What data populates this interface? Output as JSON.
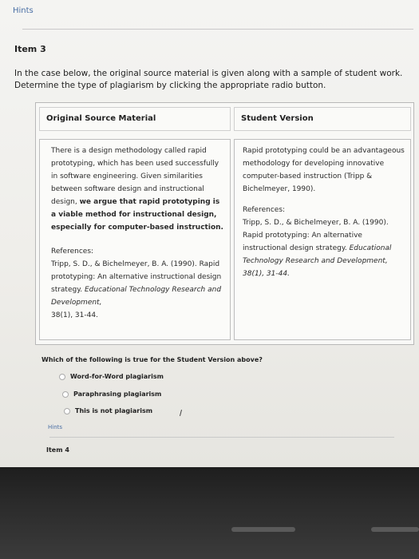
{
  "header": {
    "hints_label": "Hints"
  },
  "item": {
    "title": "Item 3"
  },
  "instructions": "In the case below, the original source material is given along with a sample of student work. Determine the type of plagiarism by clicking the appropriate radio button.",
  "table": {
    "left_header": "Original Source Material",
    "right_header": "Student Version",
    "original": {
      "p1": "There is a design methodology called rapid prototyping, which has been used successfully in software engineering. Given similarities between software design and instructional design, ",
      "p1_bold": "we argue that rapid prototyping is a viable method for instructional design, especially for computer-based instruction.",
      "ref_label": "References:",
      "ref_text": "Tripp, S. D., & Bichelmeyer, B. A. (1990). Rapid prototyping: An alternative instructional design strategy. ",
      "ref_italic": "Educational Technology Research and Development,",
      "ref_end": "38(1), 31-44."
    },
    "student": {
      "p1": "Rapid prototyping could be an advantageous methodology for developing innovative computer-based instruction (Tripp & Bichelmeyer, 1990).",
      "ref_label": "References:",
      "ref_text": "Tripp, S. D., & Bichelmeyer, B. A. (1990). Rapid prototyping: An alternative instructional design strategy. ",
      "ref_italic": "Educational Technology Research and Development,",
      "ref_end": "38(1), 31-44."
    }
  },
  "question": "Which of the following is true for the Student Version above?",
  "options": [
    "Word-for-Word plagiarism",
    "Paraphrasing plagiarism",
    "This is not plagiarism"
  ],
  "footer": {
    "hints_label": "Hints",
    "next_item": "Item 4"
  }
}
